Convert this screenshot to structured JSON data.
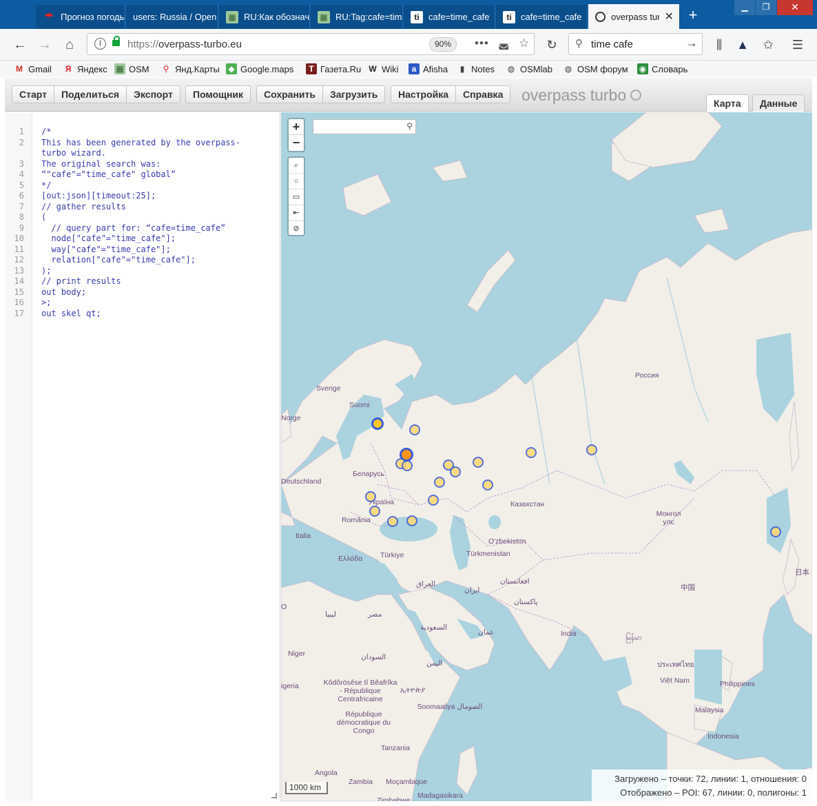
{
  "tabs": [
    {
      "label": "Прогноз погоды",
      "icon": "umbrella-icon"
    },
    {
      "label": "users: Russia / Open",
      "icon": "none"
    },
    {
      "label": "RU:Как обозначить",
      "icon": "map-icon"
    },
    {
      "label": "RU:Tag:cafe=time",
      "icon": "map-icon"
    },
    {
      "label": "cafe=time_cafe",
      "icon": "taginfo-icon"
    },
    {
      "label": "cafe=time_cafe",
      "icon": "taginfo-icon"
    },
    {
      "label": "overpass turbo",
      "icon": "steering-wheel-icon",
      "active": true
    }
  ],
  "nav": {
    "url_scheme": "https://",
    "url_host": "overpass-turbo.eu",
    "zoom": "90%",
    "search_value": "time cafe"
  },
  "bookmarks": [
    "Gmail",
    "Яндекс",
    "OSM",
    "Янд.Карты",
    "Google.maps",
    "Газета.Ru",
    "Wiki",
    "Afisha",
    "Notes",
    "OSMlab",
    "OSM форум",
    "Словарь"
  ],
  "toolbar": {
    "groups": [
      [
        "Старт",
        "Поделиться",
        "Экспорт"
      ],
      [
        "Помощник"
      ],
      [
        "Сохранить",
        "Загрузить"
      ],
      [
        "Настройка",
        "Справка"
      ]
    ],
    "brand": "overpass turbo",
    "view_tabs": [
      "Карта",
      "Данные"
    ]
  },
  "editor": {
    "lines": [
      {
        "n": "1",
        "text": "/*",
        "cls": "c-com"
      },
      {
        "n": "2",
        "text": "This has been generated by the overpass-",
        "cls": "c-com"
      },
      {
        "n": "",
        "text": "turbo wizard.",
        "cls": "c-com"
      },
      {
        "n": "3",
        "text": "The original search was:",
        "cls": "c-com"
      },
      {
        "n": "4",
        "text": "“\"cafe\"=\"time_cafe\" global”",
        "cls": "c-com"
      },
      {
        "n": "5",
        "text": "*/",
        "cls": "c-com"
      },
      {
        "n": "6",
        "text": "[out:json][timeout:25];",
        "cls": ""
      },
      {
        "n": "7",
        "text": "// gather results",
        "cls": "c-com"
      },
      {
        "n": "8",
        "text": "(",
        "cls": ""
      },
      {
        "n": "9",
        "text": "  // query part for: “cafe=time_cafe”",
        "cls": "c-com"
      },
      {
        "n": "10",
        "text": "  node[\"cafe\"=\"time_cafe\"];",
        "cls": ""
      },
      {
        "n": "11",
        "text": "  way[\"cafe\"=\"time_cafe\"];",
        "cls": ""
      },
      {
        "n": "12",
        "text": "  relation[\"cafe\"=\"time_cafe\"];",
        "cls": ""
      },
      {
        "n": "13",
        "text": ");",
        "cls": ""
      },
      {
        "n": "14",
        "text": "// print results",
        "cls": "c-com"
      },
      {
        "n": "15",
        "text": "out body;",
        "cls": ""
      },
      {
        "n": "16",
        "text": ">;",
        "cls": ""
      },
      {
        "n": "17",
        "text": "out skel qt;",
        "cls": ""
      }
    ]
  },
  "map": {
    "labels": [
      "Россия",
      "Sverige",
      "Suomi",
      "Norge",
      "Беларусь",
      "Deutschland",
      "Україна",
      "România",
      "Italia",
      "Ελλάδα",
      "Türkiye",
      "Казахстан",
      "O'zbekiston",
      "Türkmenistan",
      "Монгол улс",
      "中国",
      "日本",
      "العراق",
      "ایران",
      "افغانستان",
      "پاکستان",
      "India",
      "ليبيا",
      "مصر",
      "السعودية",
      "عمان",
      "السودان",
      "اليمن",
      "Niger",
      "Kôdôrösêse tî Bêafrîka - République Centrafricaine",
      "République démocratique du Congo",
      "ኢትዮጵያ",
      "Soomaaliya الصومال",
      "Tanzania",
      "Angola",
      "Zambia",
      "Moçambique",
      "Zimbabwe",
      "Madagasikara",
      "မြန်မာ",
      "ประเทศไทย",
      "Việt Nam",
      "Philippines",
      "Malaysia",
      "Indonesia",
      "igeria",
      "O"
    ],
    "scale": "1000 km",
    "stats_loaded": "Загружено – точки: 72, линии: 1, отношения: 0",
    "stats_shown": "Отображено – POI: 67, линии: 0, полигоны: 1",
    "colors": {
      "water": "#aad3df",
      "land": "#f2efe9",
      "marker_fill": "#fbd870",
      "marker_stroke": "#3a5bd9",
      "marker_hot": "#f7941d"
    }
  }
}
